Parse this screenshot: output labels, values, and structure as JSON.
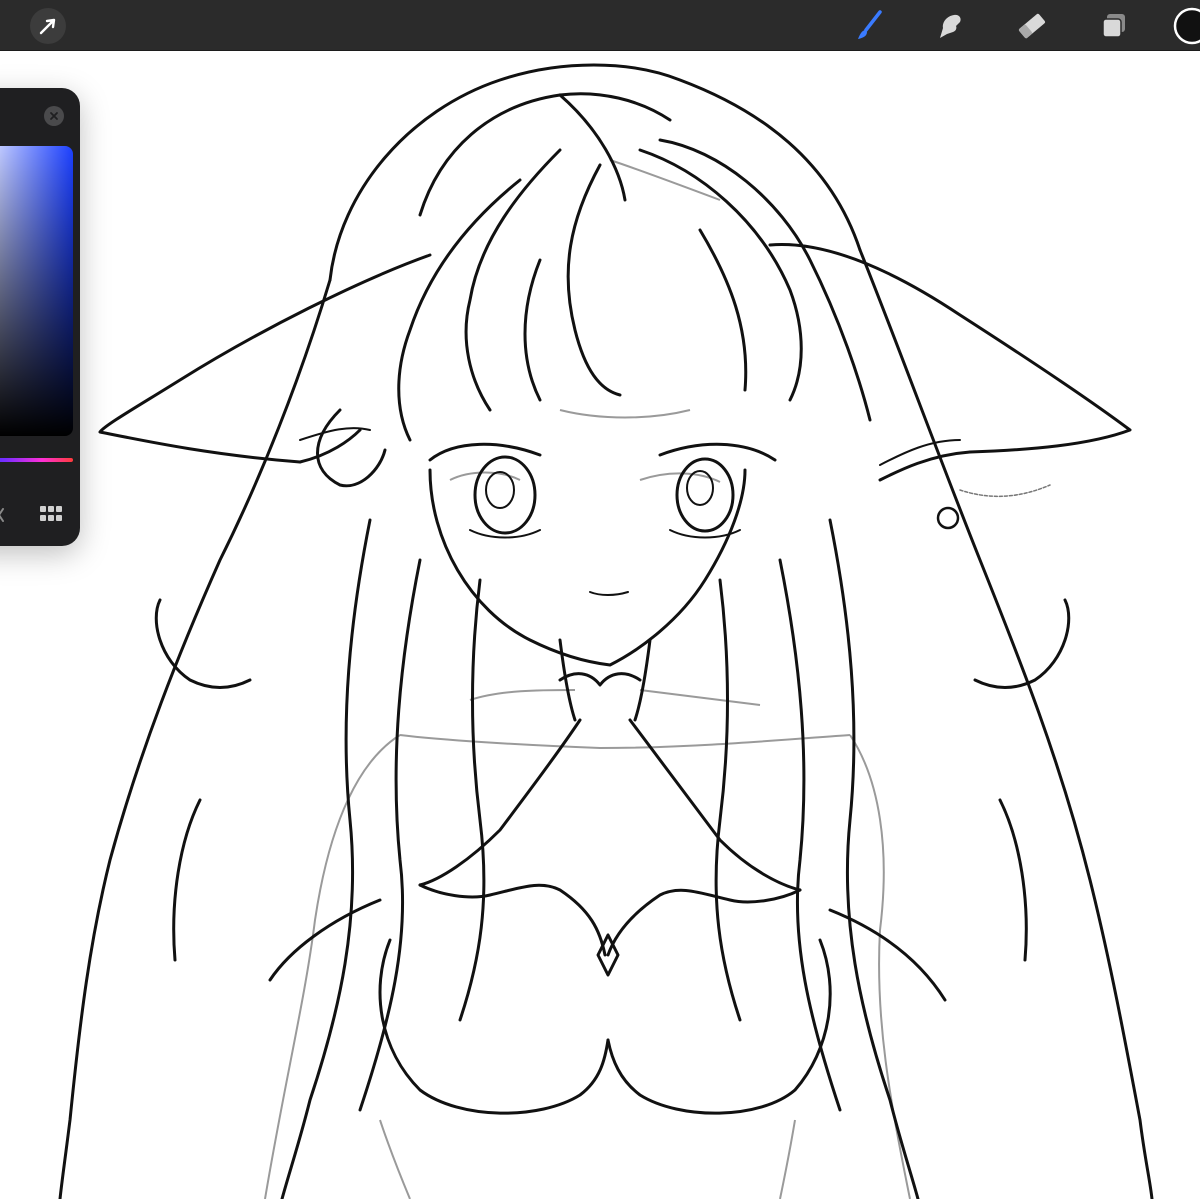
{
  "toolbar": {
    "left_tools": [
      {
        "icon": "transform-arrow-icon"
      }
    ],
    "right_tools": [
      {
        "icon": "brush-icon",
        "active": true
      },
      {
        "icon": "smudge-icon",
        "active": false
      },
      {
        "icon": "eraser-icon",
        "active": false
      },
      {
        "icon": "layers-icon",
        "active": false
      },
      {
        "icon": "color-swatch-icon",
        "active": false
      }
    ]
  },
  "color_panel": {
    "selected_hue_color": "#1c40ff",
    "icons": [
      "close-icon",
      "palette-grid-icon"
    ]
  },
  "colors": {
    "toolbar_bg": "#2b2b2b",
    "active_tool": "#3a7bff",
    "line_art": "#111111",
    "sketch": "#9a9a9a"
  }
}
